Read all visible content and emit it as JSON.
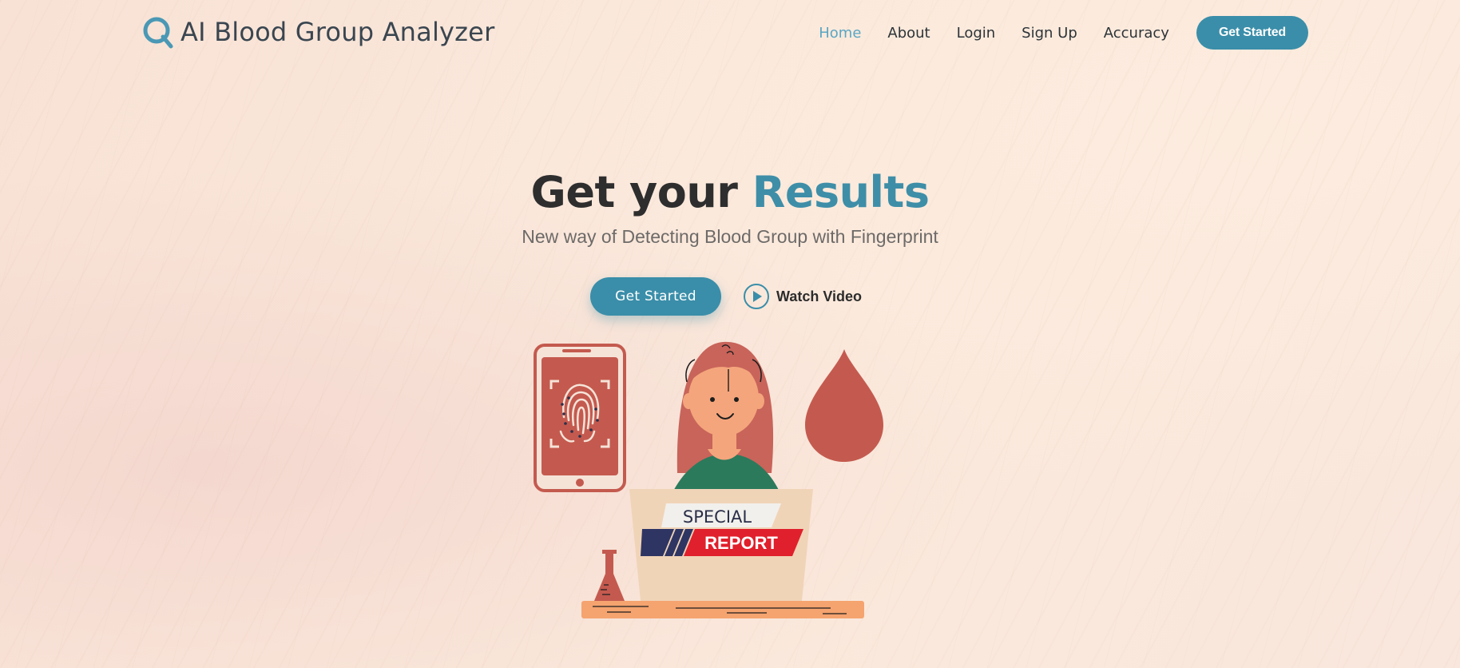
{
  "brand": {
    "name": "AI Blood Group Analyzer"
  },
  "nav": {
    "items": [
      {
        "label": "Home",
        "active": true
      },
      {
        "label": "About",
        "active": false
      },
      {
        "label": "Login",
        "active": false
      },
      {
        "label": "Sign Up",
        "active": false
      },
      {
        "label": "Accuracy",
        "active": false
      }
    ],
    "cta_label": "Get Started"
  },
  "hero": {
    "title_prefix": "Get your ",
    "title_accent": "Results",
    "subtitle": "New way of Detecting Blood Group with Fingerprint",
    "primary_button": "Get Started",
    "video_button": "Watch Video"
  },
  "illustration": {
    "laptop_line1": "SPECIAL",
    "laptop_line2": "REPORT"
  },
  "colors": {
    "accent": "#3a8ea9",
    "active_nav": "#5aa6c4",
    "blood_red": "#c45a4f",
    "text_dark": "#2e2e2e"
  }
}
